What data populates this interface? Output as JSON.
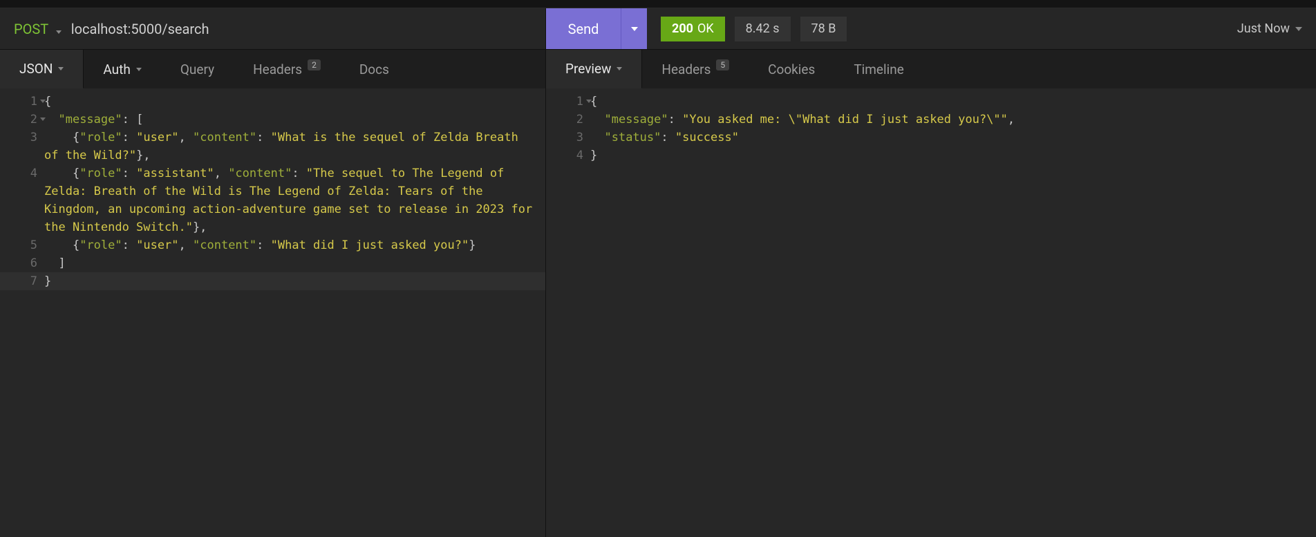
{
  "request": {
    "method": "POST",
    "url": "localhost:5000/search",
    "send_label": "Send"
  },
  "response": {
    "status_code": "200",
    "status_text": "OK",
    "time": "8.42 s",
    "size": "78 B",
    "age": "Just Now"
  },
  "left_tabs": {
    "body": {
      "label": "JSON",
      "active": true,
      "has_caret": true
    },
    "auth": {
      "label": "Auth",
      "active": false,
      "has_caret": true
    },
    "query": {
      "label": "Query"
    },
    "headers": {
      "label": "Headers",
      "badge": "2"
    },
    "docs": {
      "label": "Docs"
    }
  },
  "right_tabs": {
    "preview": {
      "label": "Preview",
      "active": true,
      "has_caret": true
    },
    "headers": {
      "label": "Headers",
      "badge": "5"
    },
    "cookies": {
      "label": "Cookies"
    },
    "timeline": {
      "label": "Timeline"
    }
  },
  "request_body_lines": [
    {
      "n": "1",
      "fold": true,
      "html": "<span class='tok-punc'>{</span>"
    },
    {
      "n": "2",
      "fold": true,
      "html": "  <span class='tok-key'>\"message\"</span><span class='tok-punc'>: [</span>"
    },
    {
      "n": "3",
      "html": "    <span class='tok-punc'>{</span><span class='tok-key'>\"role\"</span><span class='tok-punc'>: </span><span class='tok-str'>\"user\"</span><span class='tok-punc'>, </span><span class='tok-key'>\"content\"</span><span class='tok-punc'>: </span><span class='tok-str'>\"What is the sequel of Zelda Breath of the Wild?\"</span><span class='tok-punc'>},</span>"
    },
    {
      "n": "4",
      "html": "    <span class='tok-punc'>{</span><span class='tok-key'>\"role\"</span><span class='tok-punc'>: </span><span class='tok-str'>\"assistant\"</span><span class='tok-punc'>, </span><span class='tok-key'>\"content\"</span><span class='tok-punc'>: </span><span class='tok-str'>\"The sequel to The Legend of Zelda: Breath of the Wild is The Legend of Zelda: Tears of the Kingdom, an upcoming action-adventure game set to release in 2023 for the Nintendo Switch.\"</span><span class='tok-punc'>},</span>"
    },
    {
      "n": "5",
      "html": "    <span class='tok-punc'>{</span><span class='tok-key'>\"role\"</span><span class='tok-punc'>: </span><span class='tok-str'>\"user\"</span><span class='tok-punc'>, </span><span class='tok-key'>\"content\"</span><span class='tok-punc'>: </span><span class='tok-str'>\"What did I just asked you?\"</span><span class='tok-punc'>}</span>"
    },
    {
      "n": "6",
      "html": "  <span class='tok-punc'>]</span>"
    },
    {
      "n": "7",
      "hl": true,
      "html": "<span class='tok-punc'>}</span>"
    }
  ],
  "response_body_lines": [
    {
      "n": "1",
      "fold": true,
      "html": "<span class='tok-punc'>{</span>"
    },
    {
      "n": "2",
      "html": "  <span class='tok-key'>\"message\"</span><span class='tok-punc'>: </span><span class='tok-str'>\"You asked me: \\\"What did I just asked you?\\\"\"</span><span class='tok-punc'>,</span>"
    },
    {
      "n": "3",
      "html": "  <span class='tok-key'>\"status\"</span><span class='tok-punc'>: </span><span class='tok-str'>\"success\"</span>"
    },
    {
      "n": "4",
      "html": "<span class='tok-punc'>}</span>"
    }
  ]
}
